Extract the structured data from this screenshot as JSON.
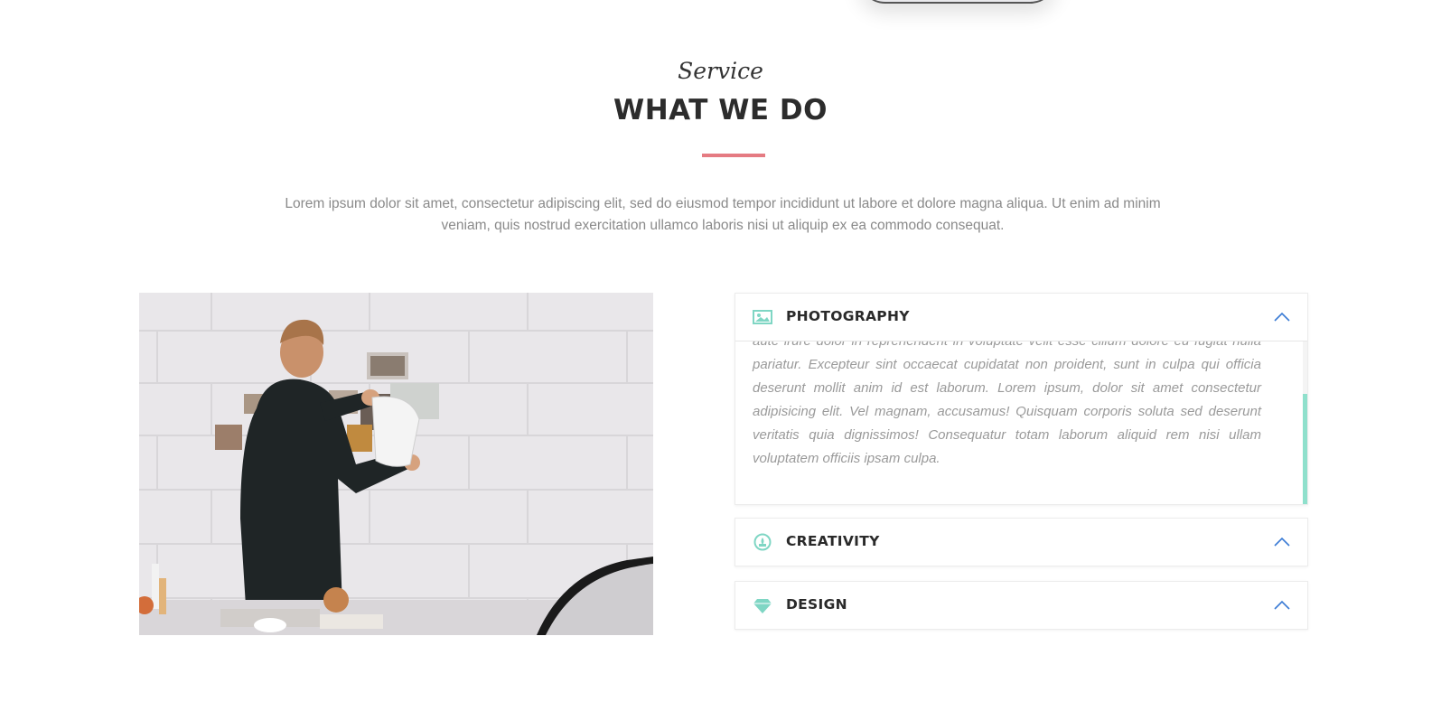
{
  "section": {
    "subtitle": "Service",
    "title": "WHAT WE DO",
    "intro": "Lorem ipsum dolor sit amet, consectetur adipiscing elit, sed do eiusmod tempor incididunt ut labore et dolore magna aliqua. Ut enim ad minim veniam, quis nostrud exercitation ullamco laboris nisi ut aliquip ex ea commodo consequat."
  },
  "accordion": {
    "items": [
      {
        "title": "PHOTOGRAPHY",
        "icon": "image-icon",
        "expanded": true,
        "body": "aute irure dolor in reprehenderit in voluptate velit esse cillum dolore eu fugiat nulla pariatur. Excepteur sint occaecat cupidatat non proident, sunt in culpa qui officia deserunt mollit anim id est laborum. Lorem ipsum, dolor sit amet consectetur adipisicing elit. Vel magnam, accusamus! Quisquam corporis soluta sed deserunt veritatis quia dignissimos! Consequatur totam laborum aliquid rem nisi ullam voluptatem officiis ipsam culpa."
      },
      {
        "title": "CREATIVITY",
        "icon": "creativity-icon",
        "expanded": false
      },
      {
        "title": "DESIGN",
        "icon": "diamond-icon",
        "expanded": false
      }
    ]
  },
  "colors": {
    "accent": "#e57b82",
    "icon": "#7fd6c4",
    "chevron": "#3a7bd5",
    "scrollbar": "#8fe0cc"
  }
}
